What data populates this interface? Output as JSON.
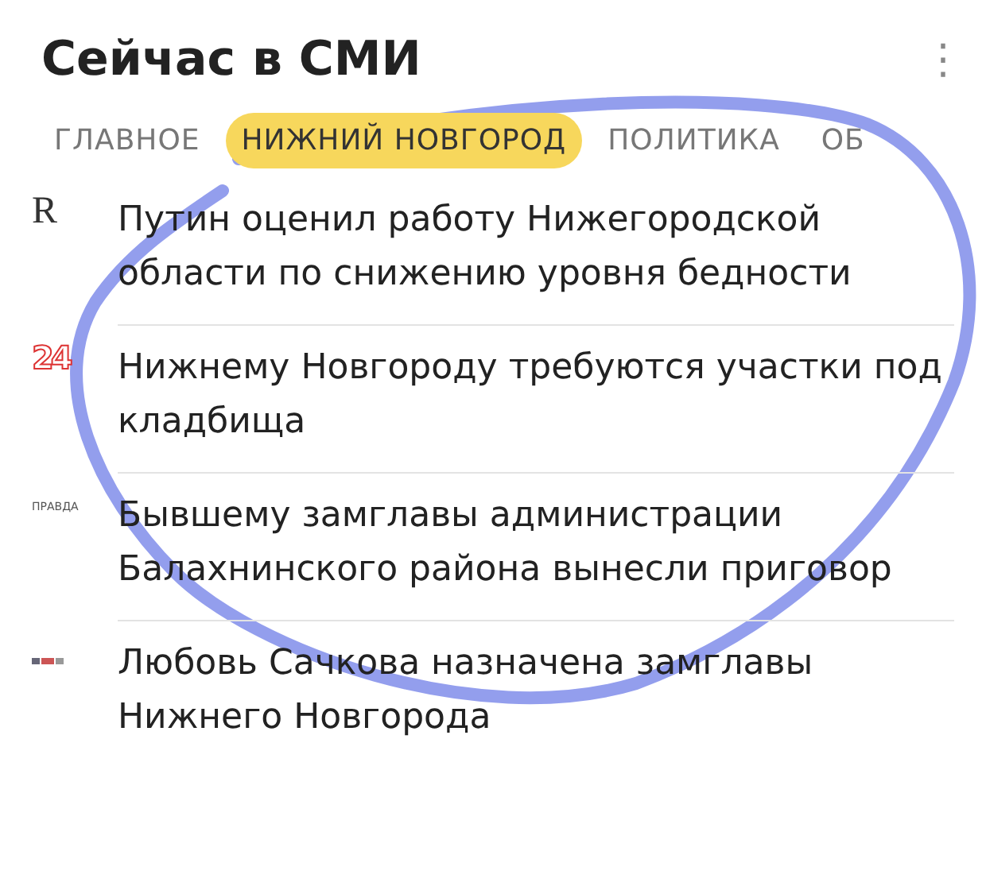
{
  "header": {
    "title": "Сейчас в СМИ",
    "menu_icon": "⋮"
  },
  "tabs": [
    {
      "label": "ГЛАВНОЕ",
      "selected": false
    },
    {
      "label": "НИЖНИЙ НОВГОРОД",
      "selected": true
    },
    {
      "label": "ПОЛИТИКА",
      "selected": false
    },
    {
      "label": "ОБ",
      "selected": false
    }
  ],
  "news": [
    {
      "source": {
        "kind": "serif",
        "text": "R"
      },
      "headline": "Путин оценил работу Нижегородской области по снижению уровня бедности"
    },
    {
      "source": {
        "kind": "outlined",
        "text": "24"
      },
      "headline": "Нижнему Новгороду требуются участки под кладбища"
    },
    {
      "source": {
        "kind": "tiny",
        "text": "ПРАВДА"
      },
      "headline": "Бывшему замглавы администрации Балахнинского района вынесли приговор"
    },
    {
      "source": {
        "kind": "mark"
      },
      "headline": "Любовь Сачкова назначена замглавы Нижнего Новгорода"
    }
  ]
}
